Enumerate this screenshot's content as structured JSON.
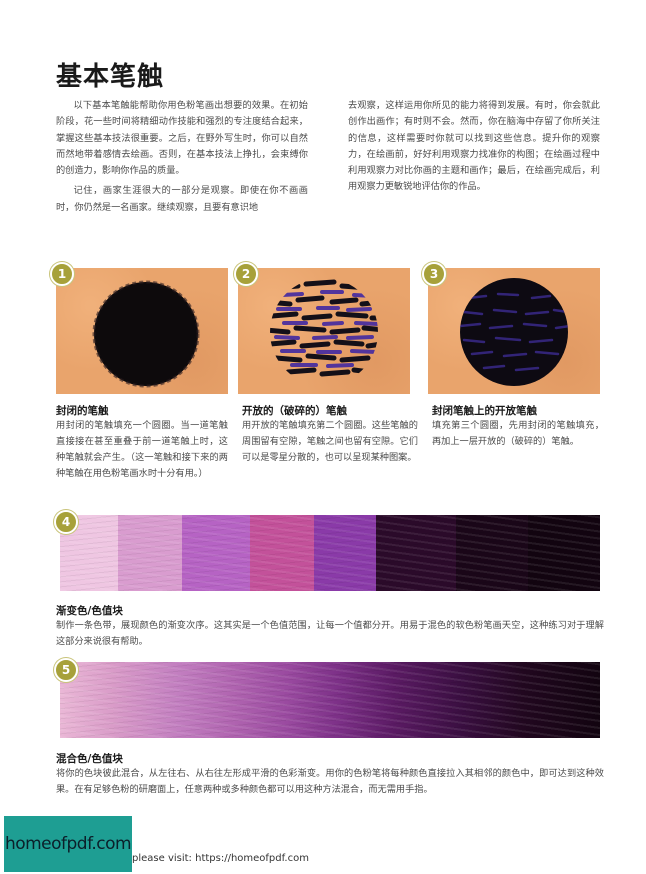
{
  "page": {
    "title": "基本笔触",
    "intro_left": [
      "以下基本笔触能帮助你用色粉笔画出想要的效果。在初始阶段，花一些时间将精细动作技能和强烈的专注度结合起来，掌握这些基本技法很重要。之后，在野外写生时，你可以自然而然地带着感情去绘画。否则，在基本技法上挣扎，会束缚你的创造力，影响你作品的质量。",
      "记住，画家生涯很大的一部分是观察。即使在你不画画时，你仍然是一名画家。继续观察，且要有意识地"
    ],
    "intro_right": [
      "去观察，这样运用你所见的能力将得到发展。有时，你会就此创作出画作；有时则不会。然而，你在脑海中存留了你所关注的信息，这样需要时你就可以找到这些信息。提升你的观察力，在绘画前，好好利用观察力找准你的构图；在绘画过程中利用观察力对比你画的主题和画作；最后，在绘画完成后，利用观察力更敏锐地评估你的作品。"
    ]
  },
  "steps": [
    {
      "num": "1",
      "title": "封闭的笔触",
      "body": "用封闭的笔触填充一个圆圈。当一道笔触直接接在甚至重叠于前一道笔触上时，这种笔触就会产生。（这一笔触和接下来的两种笔触在用色粉笔画水时十分有用。）"
    },
    {
      "num": "2",
      "title": "开放的（破碎的）笔触",
      "body": "用开放的笔触填充第二个圆圈。这些笔触的周围留有空隙，笔触之间也留有空隙。它们可以是零星分散的，也可以呈现某种图案。"
    },
    {
      "num": "3",
      "title": "封闭笔触上的开放笔触",
      "body": "填充第三个圆圈，先用封闭的笔触填充，再加上一层开放的（破碎的）笔触。"
    },
    {
      "num": "4",
      "title": "渐变色/色值块",
      "body": "制作一条色带，展现颜色的渐变次序。这其实是一个色值范围，让每一个值都分开。用易于混色的软色粉笔画天空，这种练习对于理解这部分来说很有帮助。"
    },
    {
      "num": "5",
      "title": "混合色/色值块",
      "body": "将你的色块彼此混合，从左往右、从右往左形成平滑的色彩渐变。用你的色粉笔将每种颜色直接拉入其相邻的颜色中，即可达到这种效果。在有足够色粉的研磨面上，任意两种或多种颜色都可以用这种方法混合，而无需用手指。"
    }
  ],
  "colors": {
    "paper": "#e9a46c",
    "badge": "#a7a13a",
    "value_blocks": [
      "#efc6e2",
      "#d99ccf",
      "#b663c4",
      "#c3519a",
      "#8a3aa8",
      "#2b0a2a",
      "#1a0618",
      "#120410"
    ]
  },
  "footer": {
    "logo": "homeofpdf.com",
    "text": "please visit: https://homeofpdf.com"
  }
}
